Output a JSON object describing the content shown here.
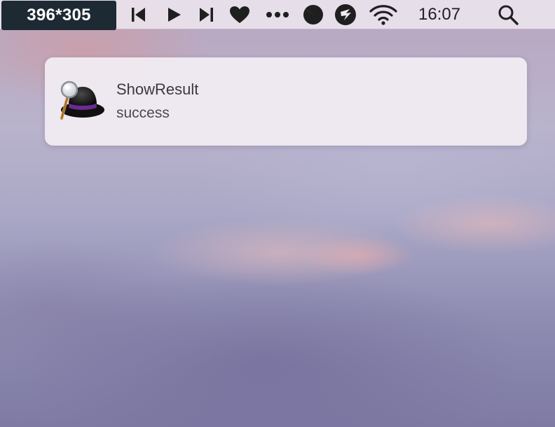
{
  "menubar": {
    "dimensions_badge": "396*305",
    "icons": [
      "previous-track-icon",
      "play-icon",
      "next-track-icon",
      "heart-icon",
      "more-dots-icon",
      "circle-app-icon",
      "app-logo-icon",
      "wifi-icon",
      "search-icon"
    ],
    "clock": "16:07"
  },
  "notification": {
    "app_icon": "alfred-hat-icon",
    "title": "ShowResult",
    "body": "success"
  },
  "colors": {
    "menubar_text": "#1f1f1f",
    "badge_background": "#1e2a33",
    "notification_background": "#f1ecf2"
  }
}
